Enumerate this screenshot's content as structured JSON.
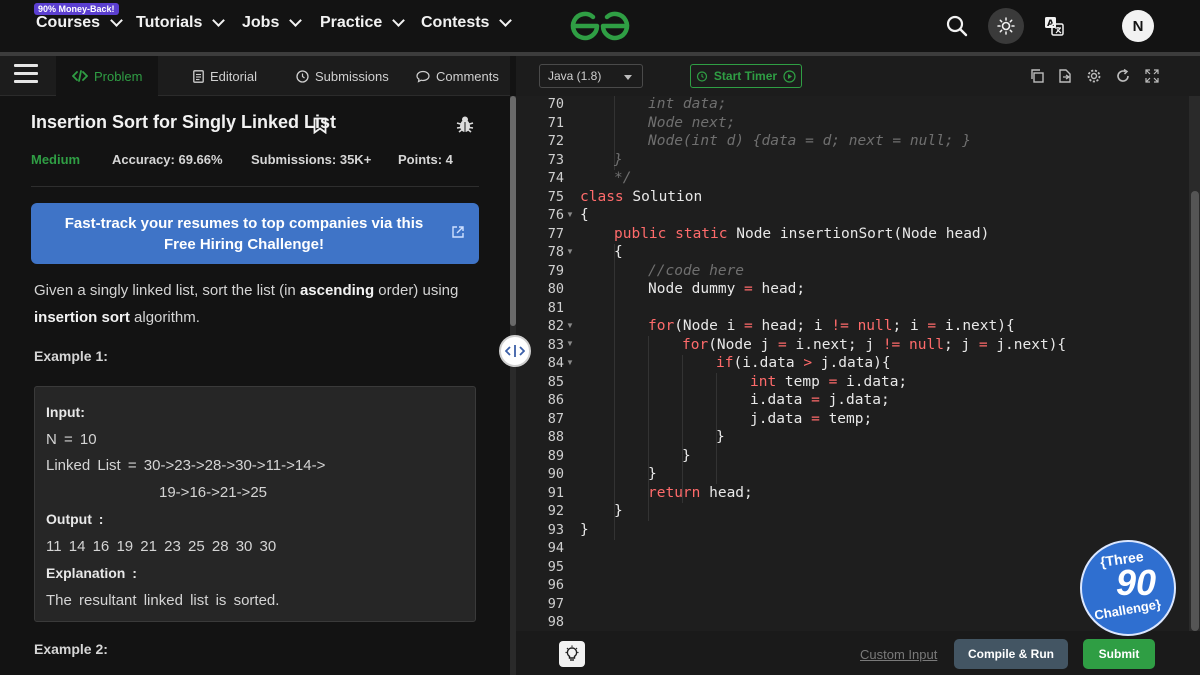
{
  "topnav": {
    "badge": "90% Money-Back!",
    "items": [
      "Courses",
      "Tutorials",
      "Jobs",
      "Practice",
      "Contests"
    ],
    "avatar_initial": "N"
  },
  "tabs": {
    "problem": "Problem",
    "editorial": "Editorial",
    "submissions": "Submissions",
    "comments": "Comments"
  },
  "problem": {
    "title": "Insertion Sort for Singly Linked List",
    "difficulty": "Medium",
    "accuracy": "Accuracy: 69.66%",
    "submissions": "Submissions: 35K+",
    "points": "Points: 4",
    "banner": "Fast-track your resumes to top companies via this Free Hiring Challenge!",
    "desc_a": "Given a singly linked list, sort the list (in ",
    "desc_b": "ascending",
    "desc_c": " order) using ",
    "desc_d": "insertion sort",
    "desc_e": " algorithm.",
    "example1_title": "Example 1:",
    "example1": {
      "input_label": "Input:",
      "n_line": "N = 10",
      "list_line1": "Linked List = 30->23->28->30->11->14->",
      "list_line2": "19->16->21->25",
      "output_label": "Output :",
      "output_value": "11 14 16 19 21 23 25 28 30 30",
      "explanation_label": "Explanation :",
      "explanation_value": "The resultant linked list is sorted."
    },
    "example2_title": "Example 2:"
  },
  "editor": {
    "language": "Java (1.8)",
    "timer": "Start Timer",
    "line_numbers": [
      "70",
      "71",
      "72",
      "73",
      "74",
      "75",
      "76",
      "77",
      "78",
      "79",
      "80",
      "81",
      "82",
      "83",
      "84",
      "85",
      "86",
      "87",
      "88",
      "89",
      "90",
      "91",
      "92",
      "93",
      "94",
      "95",
      "96",
      "97",
      "98"
    ],
    "code": {
      "l70": "int data;",
      "l71": "Node next;",
      "l72": "Node(int d) {data = d; next = null; }",
      "l73": "}",
      "l74": "*/",
      "l75a": "class",
      "l75b": " Solution",
      "l76": "{",
      "l77a": "public static",
      "l77b": " Node insertionSort(Node head)",
      "l78": "{",
      "l79": "//code here",
      "l80a": "Node dummy ",
      "l80b": "=",
      "l80c": " head;",
      "l82a": "for",
      "l82b": "(Node i ",
      "l82c": "=",
      "l82d": " head; i ",
      "l82e": "!=",
      "l82f": " ",
      "l82g": "null",
      "l82h": "; i ",
      "l82i": "=",
      "l82j": " i.next){",
      "l83a": "for",
      "l83b": "(Node j ",
      "l83c": "=",
      "l83d": " i.next; j ",
      "l83e": "!=",
      "l83f": " ",
      "l83g": "null",
      "l83h": "; j ",
      "l83i": "=",
      "l83j": " j.next){",
      "l84a": "if",
      "l84b": "(i.data ",
      "l84c": ">",
      "l84d": " j.data){",
      "l85a": "int",
      "l85b": " temp ",
      "l85c": "=",
      "l85d": " i.data;",
      "l86a": "i.data ",
      "l86b": "=",
      "l86c": " j.data;",
      "l87a": "j.data ",
      "l87b": "=",
      "l87c": " temp;",
      "l88": "}",
      "l89": "}",
      "l90": "}",
      "l91a": "return",
      "l91b": " head;",
      "l92": "}",
      "l93": "}"
    },
    "custom_input": "Custom Input",
    "compile_run": "Compile & Run",
    "submit": "Submit"
  },
  "challenge_badge": {
    "line1": "{Three",
    "line2": "90",
    "line3": "Challenge}"
  },
  "colors": {
    "accent_green": "#2f9e44",
    "banner_blue": "#3f74c7",
    "keyword_red": "#ff6b6b",
    "compile_gray": "#435563"
  }
}
